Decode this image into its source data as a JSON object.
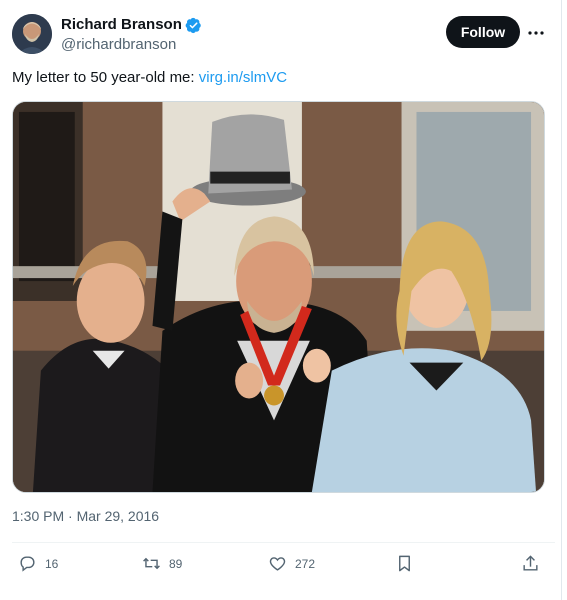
{
  "author": {
    "display_name": "Richard Branson",
    "handle": "@richardbranson",
    "verified": true,
    "avatar_icon": "avatar-photo"
  },
  "header": {
    "follow_label": "Follow",
    "more_icon": "more-horizontal-icon"
  },
  "tweet": {
    "text": "My letter to 50 year-old me: ",
    "link_text": "virg.in/slmVC",
    "timestamp": "1:30 PM · Mar 29, 2016"
  },
  "actions": {
    "replies": "16",
    "retweets": "89",
    "likes": "272"
  },
  "colors": {
    "link": "#1d9bf0",
    "follow_bg": "#0f1419",
    "muted": "#536471",
    "verified": "#1d9bf0"
  }
}
